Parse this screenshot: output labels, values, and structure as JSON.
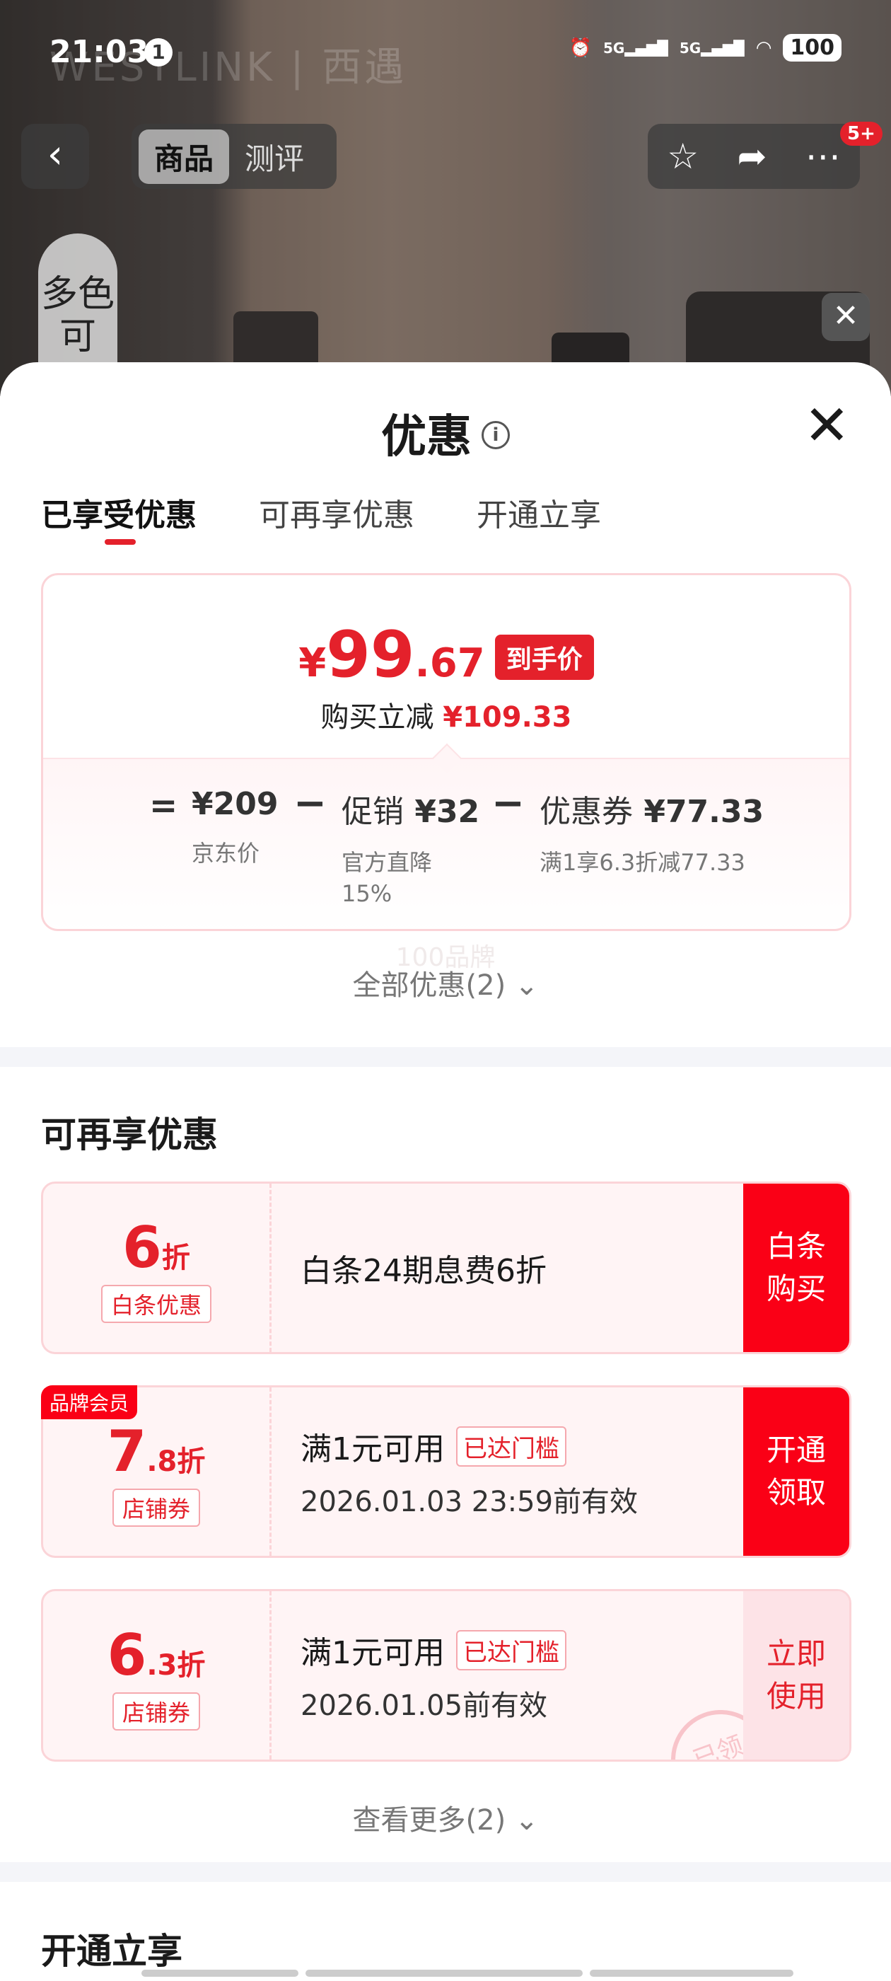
{
  "status_bar": {
    "time": "21:03",
    "notification_count": "1",
    "network_1": "5G",
    "network_2": "5G",
    "battery": "100"
  },
  "background": {
    "brand_watermark": "WESTLINK | 西遇",
    "multicolor_label": "多色可"
  },
  "nav": {
    "back_icon": "‹",
    "tabs": [
      "商品",
      "测评"
    ],
    "active_tab": 0,
    "badge": "5+"
  },
  "sheet": {
    "title": "优惠",
    "tabs": [
      "已享受优惠",
      "可再享优惠",
      "开通立享"
    ],
    "active_tab": 0
  },
  "price_card": {
    "currency": "¥",
    "price_int": "99",
    "price_dec": ".67",
    "price_tag": "到手价",
    "reduce_label": "购买立减",
    "reduce_amount": "¥109.33",
    "calc": {
      "equals": "=",
      "jd_price": "¥209",
      "jd_price_label": "京东价",
      "promo_label": "促销",
      "promo_amount": "¥32",
      "promo_sub_1": "官方直降",
      "promo_sub_2": "15%",
      "coupon_label": "优惠券",
      "coupon_amount": "¥77.33",
      "coupon_sub": "满1享6.3折减77.33"
    }
  },
  "faded_brand_text": "100品牌",
  "all_offers": "全部优惠(2)",
  "more_offers_section": {
    "title": "可再享优惠",
    "coupons": [
      {
        "num_big": "6",
        "num_small": "折",
        "type": "白条优惠",
        "line1": "白条24期息费6折",
        "action": "白条\n购买"
      },
      {
        "member_tag": "品牌会员",
        "num_big": "7",
        "num_small": ".8折",
        "type": "店铺券",
        "line1": "满1元可用",
        "threshold": "已达门槛",
        "line2": "2026.01.03 23:59前有效",
        "action": "开通\n领取"
      },
      {
        "num_big": "6",
        "num_small": ".3折",
        "type": "店铺券",
        "line1": "满1元可用",
        "threshold": "已达门槛",
        "line2": "2026.01.05前有效",
        "action": "立即\n使用",
        "stamp": "已领"
      }
    ],
    "see_more": "查看更多(2)"
  },
  "open_section": {
    "title": "开通立享"
  },
  "colors": {
    "accent_red": "#e4212b",
    "action_red": "#fa0016",
    "pale_pink": "#fff4f5",
    "border_pink": "#fbd4d8"
  }
}
